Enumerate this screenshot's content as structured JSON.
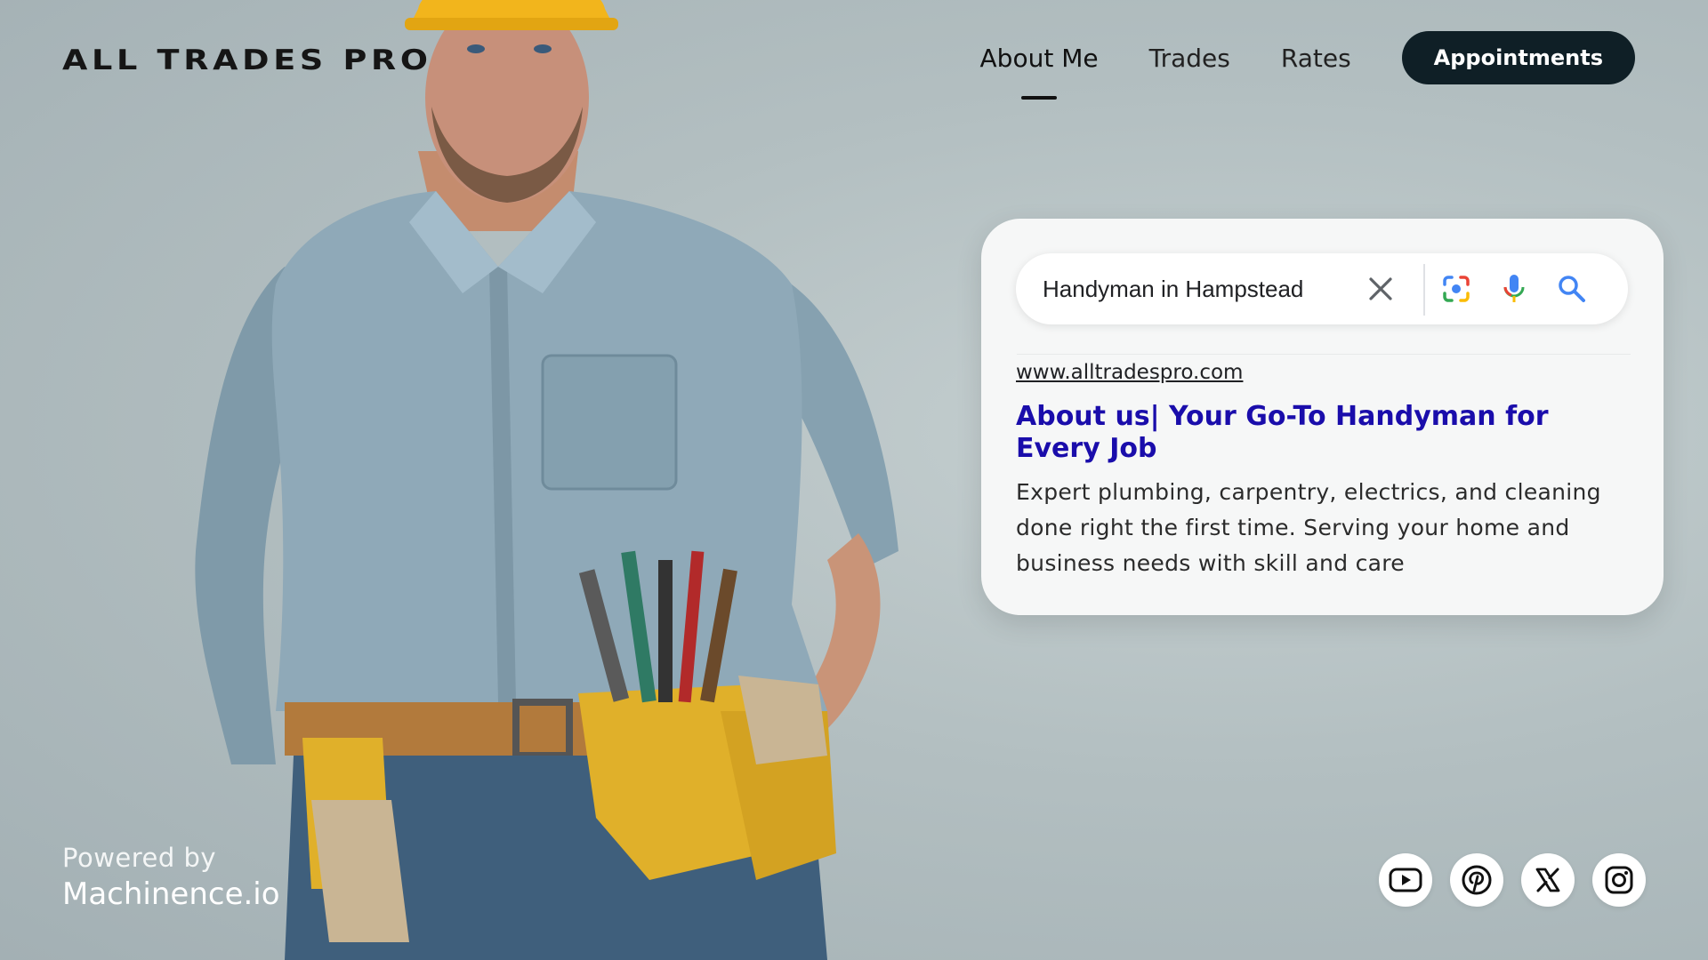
{
  "brand": {
    "logo_text": "ALL TRADES PRO"
  },
  "nav": {
    "items": [
      {
        "label": "About Me",
        "active": true
      },
      {
        "label": "Trades",
        "active": false
      },
      {
        "label": "Rates",
        "active": false
      }
    ],
    "cta_label": "Appointments"
  },
  "search": {
    "query": "Handyman in Hampstead",
    "icons": [
      "close-icon",
      "lens-icon",
      "microphone-icon",
      "search-icon"
    ]
  },
  "result": {
    "url": "www.alltradespro.com",
    "title": "About us| Your Go-To Handyman for Every Job",
    "snippet": "Expert plumbing, carpentry, electrics, and cleaning done right the first time. Serving your home and business needs with skill and care"
  },
  "footer": {
    "powered_label": "Powered by",
    "powered_brand": "Machinence.io"
  },
  "socials": [
    {
      "name": "youtube-icon"
    },
    {
      "name": "pinterest-icon"
    },
    {
      "name": "x-icon"
    },
    {
      "name": "instagram-icon"
    }
  ],
  "colors": {
    "background": "#b3bfc1",
    "cta_bg": "#0f1f26",
    "result_title": "#1a0dab",
    "helmet": "#f2b51c",
    "shirt": "#8fa9b8",
    "jeans": "#3f5f7c",
    "tool_belt": "#e0b02a"
  }
}
